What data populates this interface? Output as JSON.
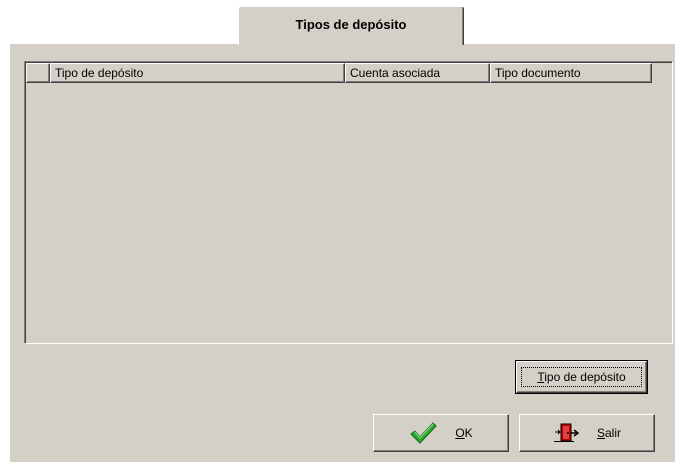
{
  "tab": {
    "label": "Tipos de depósito"
  },
  "grid": {
    "columns": [
      "Tipo de depósito",
      "Cuenta asociada",
      "Tipo documento"
    ],
    "rows": []
  },
  "buttons": {
    "tipo_deposito": {
      "mnemonic": "T",
      "rest": "ipo de depósito"
    },
    "ok": {
      "mnemonic": "O",
      "rest": "K",
      "icon": "checkmark-icon"
    },
    "salir": {
      "mnemonic": "S",
      "rest": "alir",
      "icon": "exit-door-icon"
    }
  },
  "colors": {
    "face": "#d4d0c8",
    "highlight": "#ffffff",
    "shadow": "#808080",
    "dark_shadow": "#404040",
    "check_green": "#2fa82f",
    "exit_red": "#c00000"
  }
}
